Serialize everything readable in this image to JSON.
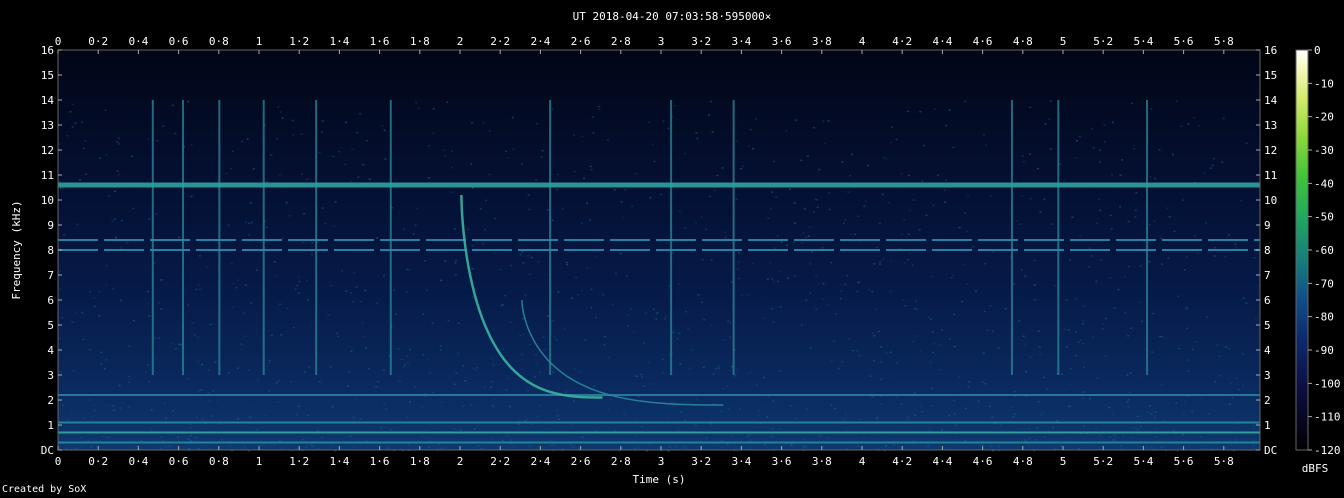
{
  "chart_data": {
    "type": "heatmap",
    "title": "UT 2018-04-20 07:03:58·595000×",
    "xlabel": "Time (s)",
    "ylabel": "Frequency (kHz)",
    "xlim": [
      0,
      5.96
    ],
    "ylim": [
      0,
      16
    ],
    "x_ticks": [
      "0",
      "0·2",
      "0·4",
      "0·6",
      "0·8",
      "1",
      "1·2",
      "1·4",
      "1·6",
      "1·8",
      "2",
      "2·2",
      "2·4",
      "2·6",
      "2·8",
      "3",
      "3·2",
      "3·4",
      "3·6",
      "3·8",
      "4",
      "4·2",
      "4·4",
      "4·6",
      "4·8",
      "5",
      "5·2",
      "5·4",
      "5·6",
      "5·8"
    ],
    "y_ticks": [
      "DC",
      "1",
      "2",
      "3",
      "4",
      "5",
      "6",
      "7",
      "8",
      "9",
      "10",
      "11",
      "12",
      "13",
      "14",
      "15",
      "16"
    ],
    "colorbar": {
      "label": "dBFS",
      "ticks": [
        "0",
        "-10",
        "-20",
        "-30",
        "-40",
        "-50",
        "-60",
        "-70",
        "-80",
        "-90",
        "-100",
        "-110",
        "-120"
      ],
      "range": [
        -120,
        0
      ],
      "colors": [
        "#000000",
        "#0d0d33",
        "#0d2a6e",
        "#124f8a",
        "#16807a",
        "#23a65a",
        "#58c83c",
        "#a9e24a",
        "#f0f590",
        "#ffffff"
      ]
    },
    "features": {
      "horizontal_lines_khz": [
        10.6,
        8.4,
        8.0,
        2.2,
        1.1,
        0.7,
        0.3
      ],
      "vertical_transients_s": [
        0.47,
        0.62,
        0.8,
        1.02,
        1.28,
        1.65,
        2.44,
        3.04,
        3.35,
        4.73,
        4.96,
        5.4
      ],
      "whistler_start": {
        "t": 2.0,
        "khz": 10.2
      },
      "whistler_end": {
        "t": 2.7,
        "khz": 2.1
      },
      "whistler_echo_end": {
        "t": 3.3,
        "khz": 1.8
      }
    }
  },
  "footer": {
    "credit": "Created by SoX"
  }
}
